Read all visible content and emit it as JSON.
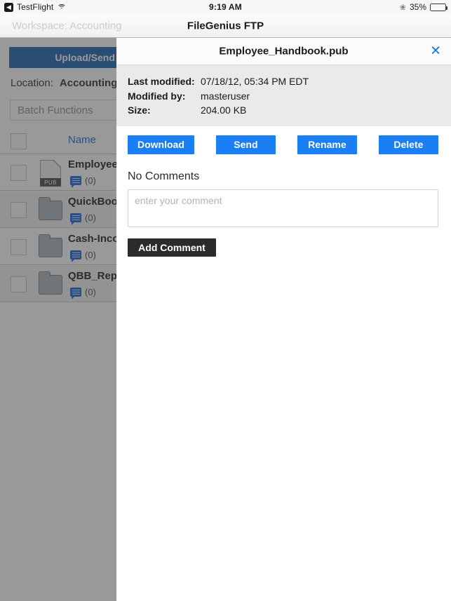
{
  "status_bar": {
    "back_icon": "back-chevron-icon",
    "app_name": "TestFlight",
    "wifi_icon": "wifi-icon",
    "time": "9:19 AM",
    "bluetooth_icon": "bluetooth-icon",
    "battery_percent": "35%",
    "battery_level": 35
  },
  "nav_bar": {
    "workspace": "Workspace: Accounting",
    "title": "FileGenius FTP"
  },
  "background_page": {
    "upload_button": "Upload/Send Files",
    "location_label": "Location:",
    "location_value": "Accounting",
    "batch_placeholder": "Batch Functions",
    "column_name": "Name",
    "rows": [
      {
        "name": "Employee_Handbook.pub",
        "type": "file",
        "badge": "PUB",
        "comments": "(0)"
      },
      {
        "name": "QuickBooks",
        "type": "folder",
        "badge": "",
        "comments": "(0)"
      },
      {
        "name": "Cash-Income",
        "type": "folder",
        "badge": "",
        "comments": "(0)"
      },
      {
        "name": "QBB_Reports",
        "type": "folder",
        "badge": "",
        "comments": "(0)"
      }
    ]
  },
  "modal": {
    "title": "Employee_Handbook.pub",
    "close_icon": "close-icon",
    "metadata": [
      {
        "label": "Last modified:",
        "value": "07/18/12, 05:34 PM EDT"
      },
      {
        "label": "Modified by:",
        "value": "masteruser"
      },
      {
        "label": "Size:",
        "value": "204.00 KB"
      }
    ],
    "actions": [
      {
        "label": "Download"
      },
      {
        "label": "Send"
      },
      {
        "label": "Rename"
      },
      {
        "label": "Delete"
      }
    ],
    "comments_heading": "No Comments",
    "comment_placeholder": "enter your comment",
    "comment_value": "",
    "add_comment_label": "Add Comment"
  },
  "colors": {
    "accent_blue": "#1a7ef5",
    "link_blue": "#1565d8",
    "upload_blue": "#1761b0",
    "dark_button": "#2b2b2b",
    "meta_band": "#eaeaea"
  }
}
